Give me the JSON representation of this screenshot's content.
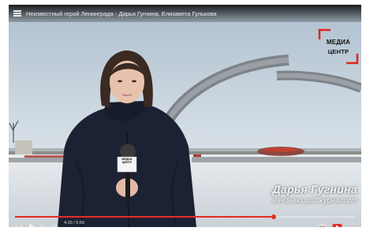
{
  "video": {
    "title": "Неизвестный герой Ленинграда - Дарья Гугнина, Елизавета Гулькова",
    "progress_fraction": 0.76
  },
  "logo": {
    "line1": "МЕДИА",
    "line2": "ЦЕНТР",
    "accent_color": "#e1251b"
  },
  "lower_third": {
    "name": "Дарья Гугнина",
    "role": "начинающий журналист"
  },
  "microphone": {
    "label": "МЕДИА ЦЕНТР"
  },
  "controls": {
    "time": "4:20 / 5:59",
    "icons": [
      "skip-previous-icon",
      "play-icon",
      "skip-next-icon",
      "volume-icon",
      "subtitles-icon",
      "youtube-icon",
      "fullscreen-icon"
    ],
    "progress_color": "#e52d27"
  }
}
